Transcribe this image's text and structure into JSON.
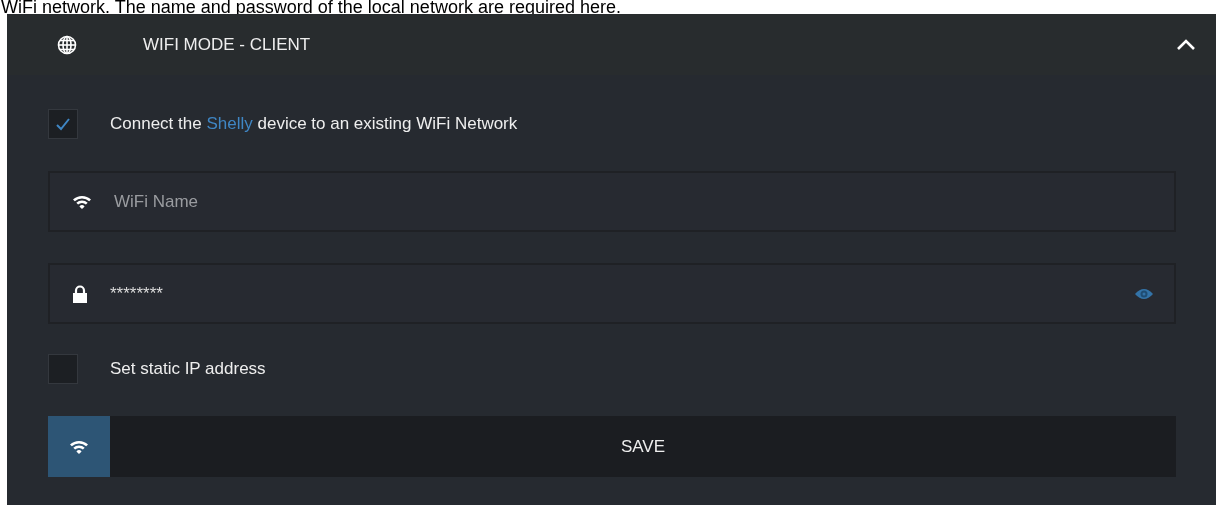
{
  "intro": "WiFi network. The name and password of the local network are required here.",
  "panel": {
    "title": "WIFI MODE - CLIENT",
    "expanded": true
  },
  "connect": {
    "checked": true,
    "label_before": "Connect the",
    "highlight": "Shelly",
    "label_after": "device to an existing WiFi Network"
  },
  "fields": [
    {
      "kind": "text",
      "placeholder": "WiFi Name"
    },
    {
      "kind": "password",
      "value": "********"
    }
  ],
  "static_ip": {
    "checked": false,
    "label": "Set static IP address"
  },
  "save_button": {
    "label": "SAVE"
  }
}
